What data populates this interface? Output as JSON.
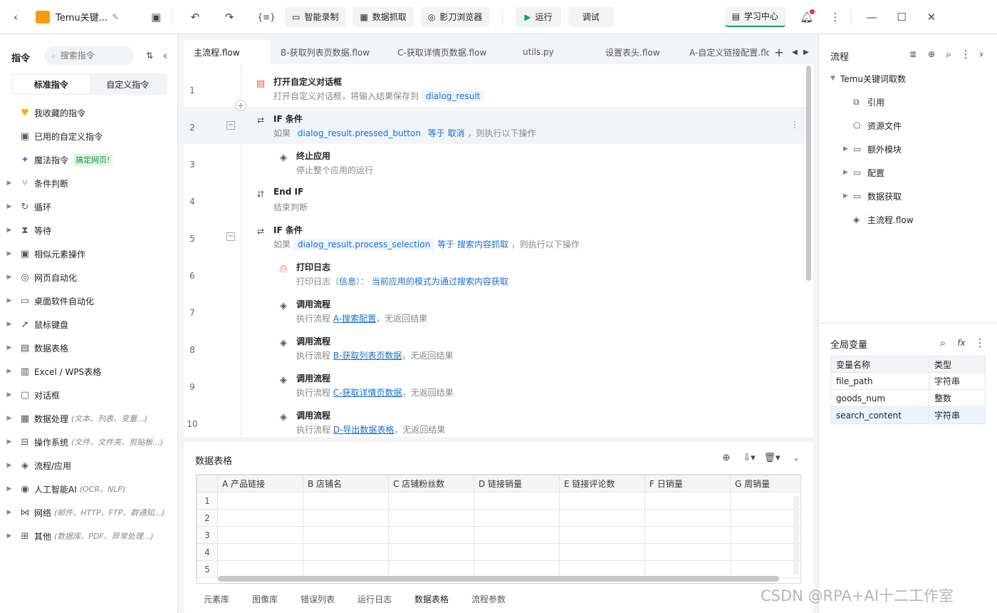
{
  "app": {
    "title": "Temu关键...",
    "learn_center": "学习中心"
  },
  "toolbar": {
    "smart_record": "智能录制",
    "data_capture": "数据抓取",
    "shadow_browser": "影刀浏览器",
    "run": "运行",
    "debug": "调试"
  },
  "left": {
    "title": "指令",
    "search_placeholder": "搜索指令",
    "tab_standard": "标准指令",
    "tab_custom": "自定义指令",
    "fav": "我收藏的指令",
    "used_custom": "已用的自定义指令",
    "magic": "魔法指令",
    "magic_badge": "搞定网页!",
    "categories": [
      {
        "label": "条件判断",
        "sub": "",
        "icon": "branch-icon"
      },
      {
        "label": "循环",
        "sub": "",
        "icon": "loop-icon"
      },
      {
        "label": "等待",
        "sub": "",
        "icon": "hourglass-icon"
      },
      {
        "label": "相似元素操作",
        "sub": "",
        "icon": "similar-elements-icon"
      },
      {
        "label": "网页自动化",
        "sub": "",
        "icon": "browser-icon"
      },
      {
        "label": "桌面软件自动化",
        "sub": "",
        "icon": "desktop-icon"
      },
      {
        "label": "鼠标键盘",
        "sub": "",
        "icon": "cursor-icon"
      },
      {
        "label": "数据表格",
        "sub": "",
        "icon": "table-icon"
      },
      {
        "label": "Excel / WPS表格",
        "sub": "",
        "icon": "excel-icon"
      },
      {
        "label": "对话框",
        "sub": "",
        "icon": "dialog-icon"
      },
      {
        "label": "数据处理",
        "sub": "(文本、列表、变量...)",
        "icon": "data-process-icon"
      },
      {
        "label": "操作系统",
        "sub": "(文件、文件夹、剪贴板...)",
        "icon": "os-icon"
      },
      {
        "label": "流程/应用",
        "sub": "",
        "icon": "layers-icon"
      },
      {
        "label": "人工智能AI",
        "sub": "(OCR、NLP)",
        "icon": "ai-icon"
      },
      {
        "label": "网络",
        "sub": "(邮件、HTTP、FTP、群通知...)",
        "icon": "network-icon"
      },
      {
        "label": "其他",
        "sub": "(数据库、PDF、异常处理...)",
        "icon": "grid-icon"
      }
    ]
  },
  "tabs": [
    "主流程.flow",
    "B-获取列表页数据.flow",
    "C-获取详情页数据.flow",
    "utils.py",
    "设置表头.flow",
    "A-自定义链接配置.flo"
  ],
  "flow": {
    "s1": {
      "n": "1",
      "t": "打开自定义对话框",
      "d": "打开自定义对话框，将输入结果保存到",
      "v": "dialog_result"
    },
    "s2": {
      "n": "2",
      "t": "IF 条件",
      "p": "如果",
      "v": "dialog_result.pressed_button",
      "op": "等于",
      "val": "取消",
      "s": "，则执行以下操作"
    },
    "s3": {
      "n": "3",
      "t": "终止应用",
      "d": "停止整个应用的运行"
    },
    "s4": {
      "n": "4",
      "t": "End IF",
      "d": "结束判断"
    },
    "s5": {
      "n": "5",
      "t": "IF 条件",
      "p": "如果",
      "v": "dialog_result.process_selection",
      "op": "等于",
      "val": "搜索内容抓取",
      "s": "，则执行以下操作"
    },
    "s6": {
      "n": "6",
      "t": "打印日志",
      "p": "打印日志（",
      "lv": "信息",
      "m": "）：",
      "msg": "当前应用的模式为通过搜索内容获取"
    },
    "s7": {
      "n": "7",
      "t": "调用流程",
      "p": "执行流程",
      "f": "A-搜索配置",
      "s": "，无返回结果"
    },
    "s8": {
      "n": "8",
      "t": "调用流程",
      "p": "执行流程",
      "f": "B-获取列表页数据",
      "s": "，无返回结果"
    },
    "s9": {
      "n": "9",
      "t": "调用流程",
      "p": "执行流程",
      "f": "C-获取详情页数据",
      "s": "，无返回结果"
    },
    "s10": {
      "n": "10",
      "t": "调用流程",
      "p": "执行流程",
      "f": "D-导出数据表格",
      "s": "，无返回结果"
    }
  },
  "table": {
    "title": "数据表格",
    "columns": [
      "A 产品链接",
      "B 店铺名",
      "C 店铺粉丝数",
      "D 链接销量",
      "E 链接评论数",
      "F 日销量",
      "G 周销量"
    ],
    "rows": [
      "1",
      "2",
      "3",
      "4",
      "5"
    ]
  },
  "bottom_tabs": [
    "元素库",
    "图像库",
    "错误列表",
    "运行日志",
    "数据表格",
    "流程参数"
  ],
  "right": {
    "title": "流程",
    "root": "Temu关键词取数",
    "items": [
      "引用",
      "资源文件",
      "额外模块",
      "配置",
      "数据获取",
      "主流程.flow"
    ],
    "vars_title": "全局变量",
    "col_name": "变量名称",
    "col_type": "类型",
    "vars": [
      {
        "name": "file_path",
        "type": "字符串"
      },
      {
        "name": "goods_num",
        "type": "整数"
      },
      {
        "name": "search_content",
        "type": "字符串"
      }
    ]
  },
  "watermark": "CSDN @RPA+AI十二工作室",
  "colors": {
    "accent": "#1a6fd0",
    "brand": "#f39c12",
    "run": "#19a05a"
  }
}
